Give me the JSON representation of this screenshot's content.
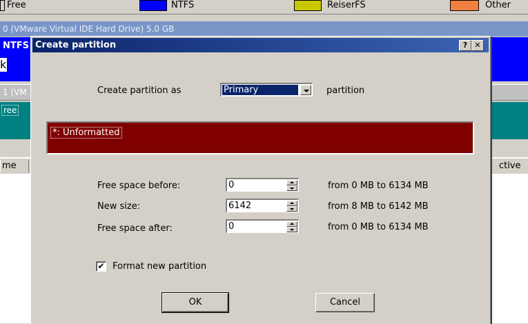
{
  "background": {
    "legend": [
      {
        "label": "Free",
        "color": "#d4d0c8"
      },
      {
        "label": "NTFS",
        "color": "#0000ff"
      },
      {
        "label": "ReiserFS",
        "color": "#c8c800"
      },
      {
        "label": "Other",
        "color": "#f08040"
      }
    ],
    "disk0_label": "0 (VMware Virtual IDE Hard Drive) 5.0 GB",
    "disk0_partition": "NTFS",
    "side_letter": "k",
    "disk1_label": "1 (VM",
    "disk1_partition": "ree",
    "list_col_left": "me",
    "list_col_right": "ctive"
  },
  "dialog": {
    "title": "Create partition",
    "help_button": "?",
    "close_button": "✕",
    "create_as_label": "Create partition as",
    "create_as_value": "Primary",
    "create_as_suffix": "partition",
    "partition_label": "*: Unformatted",
    "fields": [
      {
        "label": "Free space before:",
        "value": "0",
        "range": "from 0  MB  to 6134  MB"
      },
      {
        "label": "New size:",
        "value": "6142",
        "range": "from 8  MB  to 6142  MB"
      },
      {
        "label": "Free space after:",
        "value": "0",
        "range": "from 0  MB  to 6134  MB"
      }
    ],
    "format_checkbox_label": "Format new partition",
    "format_checked": true,
    "ok_label": "OK",
    "cancel_label": "Cancel"
  }
}
